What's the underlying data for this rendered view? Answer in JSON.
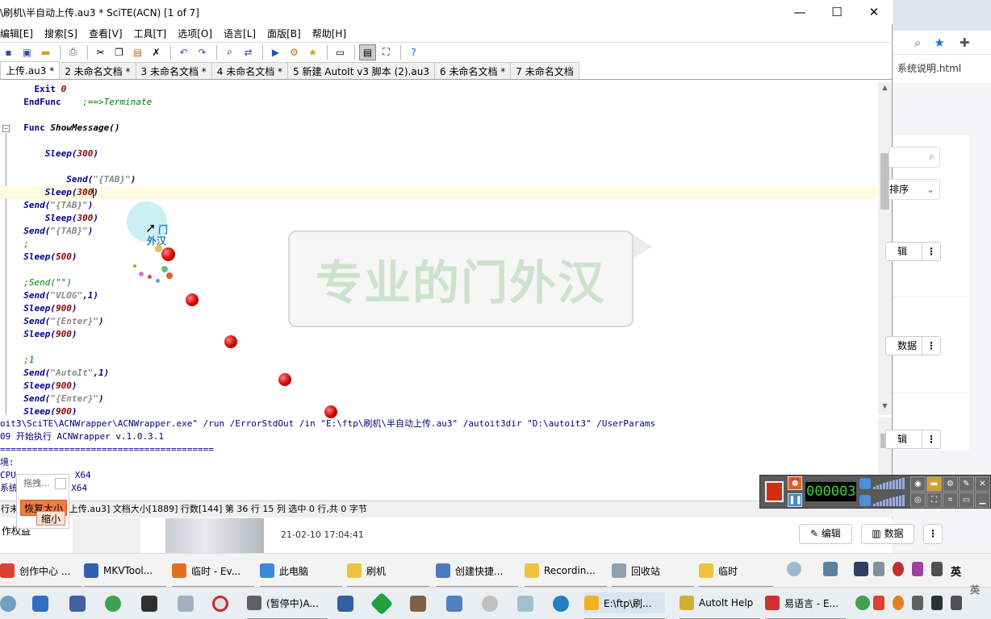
{
  "window": {
    "title": "\\刷机\\半自动上传.au3 * SciTE(ACN) [1 of 7]",
    "controls": {
      "minimize": "—",
      "maximize": "☐",
      "close": "✕"
    }
  },
  "menu": [
    "编辑[E]",
    "搜索[S]",
    "查看[V]",
    "工具[T]",
    "选项[O]",
    "语言[L]",
    "面版[B]",
    "帮助[H]"
  ],
  "tabs": [
    "上传.au3 *",
    "2 未命名文档 *",
    "3 未命名文档 *",
    "4 未命名文档 *",
    "5 新建 AutoIt v3 脚本 (2).au3",
    "6 未命名文档 *",
    "7 未命名文档"
  ],
  "editor": {
    "lines": [
      {
        "indent": "    ",
        "a": "Exit",
        "b": " 0",
        "type": "exit"
      },
      {
        "indent": "  ",
        "a": "EndFunc",
        "b": "    ;==>Terminate",
        "type": "endfunc"
      },
      {
        "indent": "",
        "a": "",
        "b": "",
        "type": "blank"
      },
      {
        "indent": "  ",
        "a": "Func",
        "b": " ShowMessage()",
        "type": "func"
      },
      {
        "indent": "",
        "a": "",
        "b": "",
        "type": "blank"
      },
      {
        "indent": "      ",
        "a": "Sleep(",
        "b": "300",
        "c": ")",
        "type": "call"
      },
      {
        "indent": "",
        "a": "",
        "b": "",
        "type": "blank"
      },
      {
        "indent": "          ",
        "a": "Send(",
        "b": "\"{TAB}\"",
        "c": ")",
        "type": "send"
      },
      {
        "indent": "      ",
        "a": "Sleep(",
        "b": "300",
        "c": ")",
        "type": "call",
        "current": true
      },
      {
        "indent": "  ",
        "a": "Send(",
        "b": "\"{TAB}\"",
        "c": ")",
        "type": "send"
      },
      {
        "indent": "      ",
        "a": "Sleep(",
        "b": "300",
        "c": ")",
        "type": "call"
      },
      {
        "indent": "  ",
        "a": "Send(",
        "b": "\"{TAB}\"",
        "c": ")",
        "type": "send"
      },
      {
        "indent": "  ",
        "a": ";",
        "b": "",
        "type": "comment"
      },
      {
        "indent": "  ",
        "a": "Sleep(",
        "b": "500",
        "c": ")",
        "type": "call"
      },
      {
        "indent": "",
        "a": "",
        "b": "",
        "type": "blank"
      },
      {
        "indent": "  ",
        "a": ";Send(\"\")",
        "b": "",
        "type": "comment"
      },
      {
        "indent": "  ",
        "a": "Send(",
        "b": "\"VLOG\"",
        "c": ",1)",
        "type": "send2"
      },
      {
        "indent": "  ",
        "a": "Sleep(",
        "b": "900",
        "c": ")",
        "type": "call"
      },
      {
        "indent": "  ",
        "a": "Send(",
        "b": "\"{Enter}\"",
        "c": ")",
        "type": "send"
      },
      {
        "indent": "  ",
        "a": "Sleep(",
        "b": "900",
        "c": ")",
        "type": "call"
      },
      {
        "indent": "",
        "a": "",
        "b": "",
        "type": "blank"
      },
      {
        "indent": "  ",
        "a": ";1",
        "b": "",
        "type": "comment"
      },
      {
        "indent": "  ",
        "a": "Send(",
        "b": "\"AutoIt\"",
        "c": ",1)",
        "type": "send2"
      },
      {
        "indent": "  ",
        "a": "Sleep(",
        "b": "900",
        "c": ")",
        "type": "call"
      },
      {
        "indent": "  ",
        "a": "Send(",
        "b": "\"{Enter}\"",
        "c": ")",
        "type": "send"
      },
      {
        "indent": "  ",
        "a": "Sleep(",
        "b": "900",
        "c": ")",
        "type": "call"
      }
    ]
  },
  "output": [
    "oit3\\SciTE\\ACNWrapper\\ACNWrapper.exe\" /run /ErrorStdOut /in \"E:\\ftp\\刷机\\半自动上传.au3\" /autoit3dir \"D:\\autoit3\" /UserParams",
    "09 开始执行 ACNWrapper v.1.0.3.1",
    "========================================",
    "境:",
    "CPU           X64",
    "系统          X64"
  ],
  "statusbar": "行末 件名[半自动上传.au3] 文档大小[1889] 行数[144] 第 36 行 15 列 选中 0 行,共 0 字节",
  "watermark": "专业的门外汉",
  "cursor_label": [
    "门",
    "外汉"
  ],
  "drag_widget": {
    "title": "拖拽...",
    "restore": "恢复大小",
    "minimize": "缩小"
  },
  "recorder": {
    "timer": "000003"
  },
  "browser": {
    "bookmark": "系统说明.html",
    "sort": "排序",
    "edit": "辑",
    "data": "数据"
  },
  "list_row": {
    "date": "21-02-10 17:04:41",
    "edit_btn": "编辑",
    "data_btn": "数据",
    "left_label": "作权益"
  },
  "taskbar_top": [
    {
      "label": "创作中心 ...",
      "color": "#e04030"
    },
    {
      "label": "MKVTool...",
      "color": "#3060b0"
    },
    {
      "label": "临时 - Ev...",
      "color": "#e07020"
    },
    {
      "label": "此电脑",
      "color": "#3a8ad8"
    },
    {
      "label": "刷机",
      "color": "#f0c040"
    },
    {
      "label": "创建快捷...",
      "color": "#4a7ac0"
    },
    {
      "label": "Recordin...",
      "color": "#f0c040"
    },
    {
      "label": "回收站",
      "color": "#90a0b0"
    },
    {
      "label": "临时",
      "color": "#f0c040"
    }
  ],
  "taskbar_bottom": [
    {
      "label": "(暂停中)A...",
      "color": "#606060"
    },
    {
      "label": "E:\\ftp\\刷...",
      "color": "#f0b020"
    },
    {
      "label": "AutoIt Help",
      "color": "#d0b030"
    },
    {
      "label": "易语言 - E...",
      "color": "#d03030"
    }
  ],
  "ime_top": "英",
  "ime_bottom": "英"
}
